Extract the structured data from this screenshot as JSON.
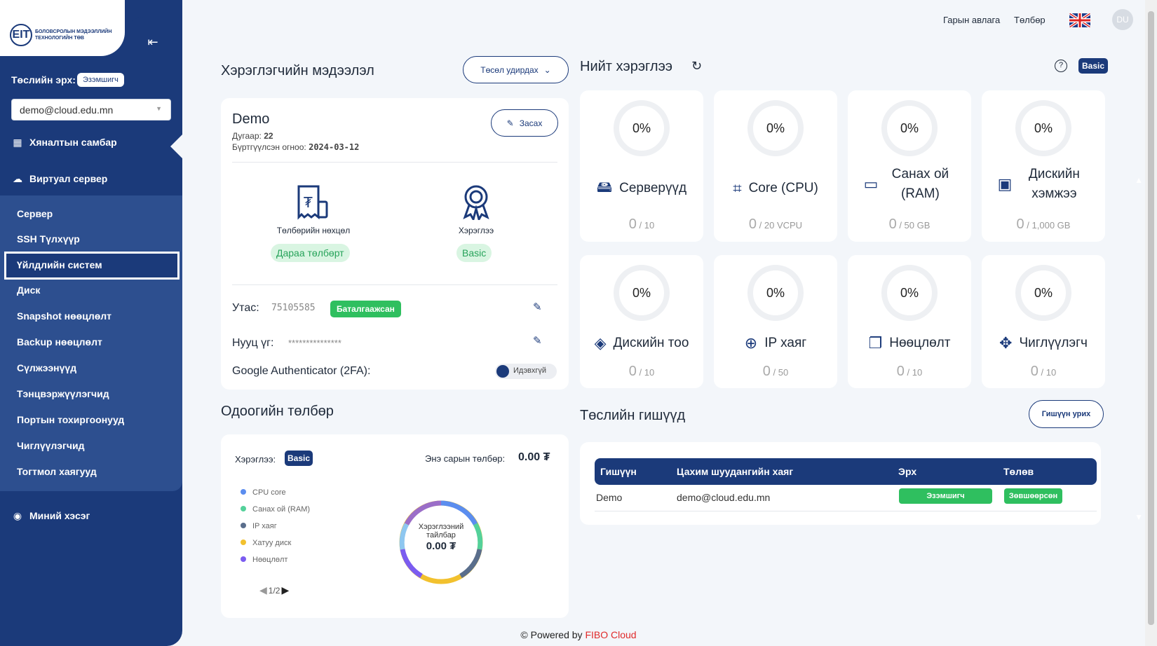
{
  "brand": {
    "logo_mark": "EIT",
    "logo_text": "БОЛОВСРОЛЫН МЭДЭЭЛЛИЙН ТЕХНОЛОГИЙН ТӨВ"
  },
  "sidebar": {
    "role_label": "Төслийн эрх:",
    "role_value": "Эзэмшигч",
    "project_value": "demo@cloud.edu.mn",
    "dashboard": "Хяналтын самбар",
    "virtual_server": "Виртуал сервер",
    "sub_items": [
      "Сервер",
      "SSH Түлхүүр",
      "Үйлдлийн систем",
      "Диск",
      "Snapshot нөөцлөлт",
      "Backup нөөцлөлт",
      "Сүлжээнүүд",
      "Тэнцвэржүүлэгчид",
      "Портын тохиргоонууд",
      "Чиглүүлэгчид",
      "Тогтмол хаягууд"
    ],
    "my_section": "Миний хэсэг"
  },
  "topbar": {
    "invoices": "Гарын авлага",
    "payment": "Төлбөр",
    "avatar": "DU"
  },
  "user_info": {
    "heading": "Хэрэглэгчийн мэдээлэл",
    "manage_button": "Төсөл удирдах",
    "name": "Demo",
    "number_label": "Дугаар:",
    "number_value": "22",
    "registered_label": "Бүртгүүлсэн огноо:",
    "registered_value": "2024-03-12",
    "edit_button": "Засах",
    "payment_terms_label": "Төлбөрийн нөхцөл",
    "payment_terms_value": "Дараа төлбөрт",
    "usage_label": "Хэрэглээ",
    "usage_value": "Basic",
    "phone_label": "Утас:",
    "phone_value": "75105585",
    "phone_status": "Баталгаажсан",
    "password_label": "Нууц үг:",
    "password_value": "***************",
    "twofa_label": "Google Authenticator (2FA):",
    "twofa_status": "Идэвхгүй"
  },
  "total_usage": {
    "heading": "Нийт хэрэглээ",
    "plan_badge": "Basic",
    "cards": [
      {
        "label": "Серверүүд",
        "percent": "0%",
        "used": "0",
        "limit": "/ 10",
        "icon": "server-icon"
      },
      {
        "label": "Core (CPU)",
        "percent": "0%",
        "used": "0",
        "limit": "/ 20 VCPU",
        "icon": "cpu-icon"
      },
      {
        "label": "Санах ой (RAM)",
        "percent": "0%",
        "used": "0",
        "limit": "/ 50 GB",
        "icon": "ram-icon"
      },
      {
        "label": "Дискийн хэмжээ",
        "percent": "0%",
        "used": "0",
        "limit": "/ 1,000 GB",
        "icon": "disk-icon"
      },
      {
        "label": "Дискийн тоо",
        "percent": "0%",
        "used": "0",
        "limit": "/ 10",
        "icon": "layers-icon"
      },
      {
        "label": "IP хаяг",
        "percent": "0%",
        "used": "0",
        "limit": "/ 50",
        "icon": "globe-icon"
      },
      {
        "label": "Нөөцлөлт",
        "percent": "0%",
        "used": "0",
        "limit": "/ 10",
        "icon": "copy-icon"
      },
      {
        "label": "Чиглүүлэгч",
        "percent": "0%",
        "used": "0",
        "limit": "/ 10",
        "icon": "router-icon"
      }
    ]
  },
  "current_payment": {
    "heading": "Одоогийн төлбөр",
    "usage_label": "Хэрэглээ:",
    "usage_badge": "Basic",
    "month_label": "Энэ сарын төлбөр:",
    "month_value": "0.00 ₮",
    "legend": [
      {
        "name": "CPU core",
        "color": "#5b8def"
      },
      {
        "name": "Санах ой (RAM)",
        "color": "#54d19a"
      },
      {
        "name": "IP хаяг",
        "color": "#5a6e8c"
      },
      {
        "name": "Хатуу диск",
        "color": "#f2c12e"
      },
      {
        "name": "Нөөцлөлт",
        "color": "#7b5cf0"
      }
    ],
    "pager": "1/2",
    "donut_title": "Хэрэглээний тайлбар",
    "donut_value": "0.00 ₮"
  },
  "members": {
    "heading": "Төслийн гишүүд",
    "invite_button": "Гишүүн урих",
    "columns": [
      "Гишүүн",
      "Цахим шуудангийн хаяг",
      "Эрх",
      "Төлөв"
    ],
    "rows": [
      {
        "member": "Demo",
        "email": "demo@cloud.edu.mn",
        "role": "Эзэмшигч",
        "status": "Зөвшөөрсөн"
      }
    ]
  },
  "footer": {
    "prefix": "© Powered by",
    "brand": "FIBO Cloud"
  }
}
